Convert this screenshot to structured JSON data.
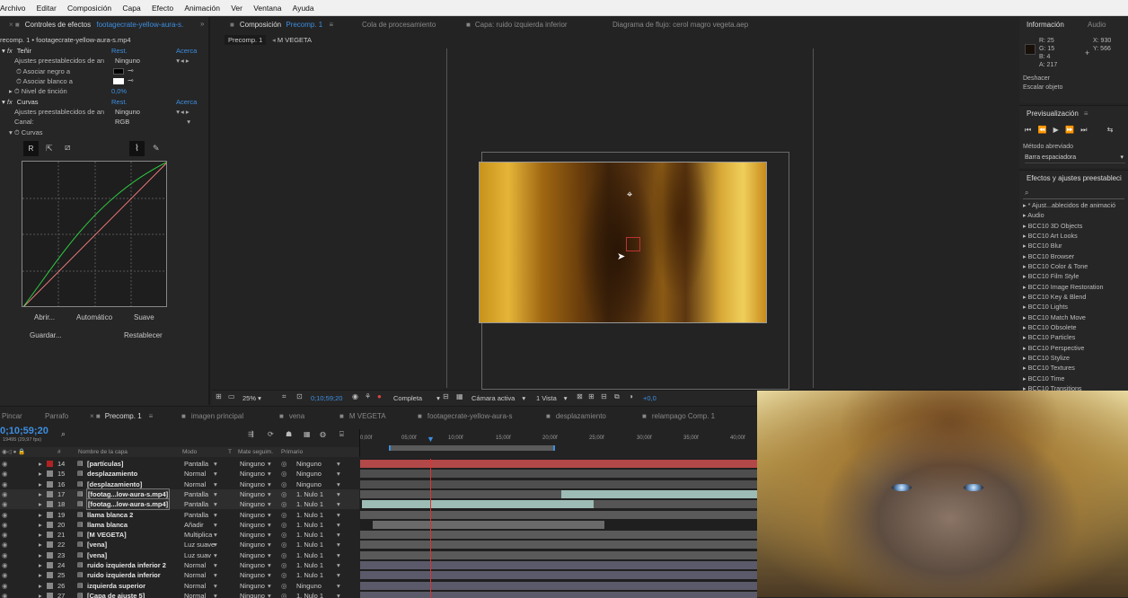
{
  "menu": [
    "Archivo",
    "Editar",
    "Composición",
    "Capa",
    "Efecto",
    "Animación",
    "Ver",
    "Ventana",
    "Ayuda"
  ],
  "effects_panel": {
    "tab_prefix": "Controles de efectos",
    "tab_layer": "footagecrate-yellow-aura-s.",
    "breadcrumb": "recomp. 1 • footagecrate-yellow-aura-s.mp4",
    "tint": {
      "fx": "fx",
      "name": "Teñir",
      "reset": "Rest.",
      "about": "Acerca",
      "preset_label": "Ajustes preestablecidos de an",
      "preset_value": "Ninguno",
      "map_black": "Asociar negro a",
      "map_white": "Asociar blanco a",
      "amount_label": "Nivel de tinción",
      "amount_value": "0,0%"
    },
    "curves": {
      "fx": "fx",
      "name": "Curvas",
      "reset": "Rest.",
      "about": "Acerca",
      "preset_label": "Ajustes preestablecidos de an",
      "preset_value": "Ninguno",
      "channel_label": "Canal:",
      "channel_value": "RGB",
      "curves_label": "Curvas",
      "channel_btn": "R",
      "btn_open": "Abrir...",
      "btn_auto": "Automático",
      "btn_smooth": "Suave",
      "btn_save": "Guardar...",
      "btn_reset": "Restablecer"
    }
  },
  "comp_panel": {
    "tab_prefix": "Composición",
    "tab_comp": "Precomp. 1",
    "tabs": [
      "Cola de procesamiento",
      "Capa: ruido izquierda inferior",
      "Diagrama de flujo: cerol magro vegeta.aep"
    ],
    "sub_tabs": [
      "Precomp. 1",
      "M VEGETA"
    ],
    "zoom": "25%",
    "timecode": "0;10;59;20",
    "resolution": "Completa",
    "camera": "Cámara activa",
    "views": "1 Vista",
    "exposure": "+0,0"
  },
  "info_panel": {
    "tab": "Información",
    "tab2": "Audio",
    "r": "R:  25",
    "g": "G:  15",
    "b": "B:  4",
    "a": "A:  217",
    "x": "X:  930",
    "y": "Y:  566",
    "line1": "Deshacer",
    "line2": "Escalar objeto"
  },
  "preview_panel": {
    "tab": "Previsualización",
    "method_label": "Método abreviado",
    "method_value": "Barra espaciadora"
  },
  "effects_presets": {
    "tab": "Efectos y ajustes preestableci",
    "items": [
      "* Ajust...ablecidos de animació",
      "Audio",
      "BCC10 3D Objects",
      "BCC10 Art Looks",
      "BCC10 Blur",
      "BCC10 Browser",
      "BCC10 Color & Tone",
      "BCC10 Film Style",
      "BCC10 Image Restoration",
      "BCC10 Key & Blend",
      "BCC10 Lights",
      "BCC10 Match Move",
      "BCC10 Obsolete",
      "BCC10 Particles",
      "BCC10 Perspective",
      "BCC10 Stylize",
      "BCC10 Textures",
      "BCC10 Time",
      "BCC10 Transitions"
    ]
  },
  "timeline": {
    "tabs": [
      "Pincar",
      "Parrafo",
      "Precomp. 1",
      "imagen principal",
      "vena",
      "M VEGETA",
      "footagecrate-yellow-aura-s",
      "desplazamiento",
      "relampago Comp. 1"
    ],
    "timecode": "0;10;59;20",
    "fps": "19495 (29,97 fps)",
    "col_num": "#",
    "col_name": "Nombre de la capa",
    "col_mode": "Modo",
    "col_t": "T",
    "col_matte": "Mate seguim.",
    "col_parent": "Primario",
    "ruler": [
      "0;00f",
      "05;00f",
      "10;00f",
      "15;00f",
      "20;00f",
      "25;00f",
      "30;00f",
      "35;00f",
      "40;00f"
    ],
    "layers": [
      {
        "num": "14",
        "name": "[partículas]",
        "mode": "Pantalla",
        "matte": "Ninguno",
        "parent": "Ninguno",
        "color": "#b22222"
      },
      {
        "num": "15",
        "name": "desplazamiento",
        "mode": "Normal",
        "matte": "Ninguno",
        "parent": "Ninguno",
        "color": "#888888"
      },
      {
        "num": "16",
        "name": "[desplazamiento]",
        "mode": "Normal",
        "matte": "Ninguno",
        "parent": "Ninguno",
        "color": "#888888"
      },
      {
        "num": "17",
        "name": "[footag...low-aura-s.mp4]",
        "mode": "Pantalla",
        "matte": "Ninguno",
        "parent": "1. Nulo 1",
        "color": "#888888"
      },
      {
        "num": "18",
        "name": "[footag...low-aura-s.mp4]",
        "mode": "Pantalla",
        "matte": "Ninguno",
        "parent": "1. Nulo 1",
        "color": "#888888"
      },
      {
        "num": "19",
        "name": "llama blanca 2",
        "mode": "Pantalla",
        "matte": "Ninguno",
        "parent": "1. Nulo 1",
        "color": "#888888"
      },
      {
        "num": "20",
        "name": "llama blanca",
        "mode": "Añadir",
        "matte": "Ninguno",
        "parent": "1. Nulo 1",
        "color": "#888888"
      },
      {
        "num": "21",
        "name": "[M VEGETA]",
        "mode": "Multiplica",
        "matte": "Ninguno",
        "parent": "1. Nulo 1",
        "color": "#888888"
      },
      {
        "num": "22",
        "name": "[vena]",
        "mode": "Luz suave",
        "matte": "Ninguno",
        "parent": "1. Nulo 1",
        "color": "#888888"
      },
      {
        "num": "23",
        "name": "[vena]",
        "mode": "Luz suav",
        "matte": "Ninguno",
        "parent": "1. Nulo 1",
        "color": "#888888"
      },
      {
        "num": "24",
        "name": "ruido izquierda inferior 2",
        "mode": "Normal",
        "matte": "Ninguno",
        "parent": "1. Nulo 1",
        "color": "#888888"
      },
      {
        "num": "25",
        "name": "ruido izquierda inferior",
        "mode": "Normal",
        "matte": "Ninguno",
        "parent": "1. Nulo 1",
        "color": "#888888"
      },
      {
        "num": "26",
        "name": "izquierda superior",
        "mode": "Normal",
        "matte": "Ninguno",
        "parent": "Ninguno",
        "color": "#888888"
      },
      {
        "num": "27",
        "name": "[Capa de ajuste 5]",
        "mode": "Normal",
        "matte": "Ninguno",
        "parent": "1. Nulo 1",
        "color": "#888888"
      }
    ]
  },
  "colors": {
    "accent": "#3d8ee0",
    "curve_green": "#2ecc40",
    "curve_red": "#d22b2b",
    "playhead": "#3d8ee0"
  }
}
